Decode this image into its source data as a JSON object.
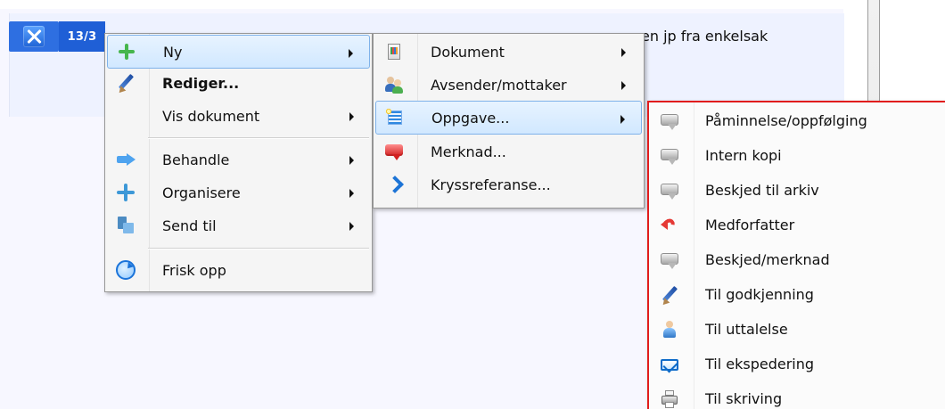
{
  "app": {
    "count_badge": "13/3",
    "background_text": "en jp fra enkelsak"
  },
  "menus": {
    "main": [
      {
        "label": "Ny",
        "icon": "plus-icon",
        "submenu": true,
        "highlight": true
      },
      {
        "label": "Rediger...",
        "icon": "pencil-icon",
        "submenu": false,
        "bold": true
      },
      {
        "label": "Vis dokument",
        "icon": "",
        "submenu": true
      },
      {
        "label": "Behandle",
        "icon": "forward-arrow-icon",
        "submenu": true
      },
      {
        "label": "Organisere",
        "icon": "move-icon",
        "submenu": true
      },
      {
        "label": "Send til",
        "icon": "send-icon",
        "submenu": true
      },
      {
        "label": "Frisk opp",
        "icon": "refresh-icon",
        "submenu": false
      }
    ],
    "ny": [
      {
        "label": "Dokument",
        "icon": "document-icon",
        "submenu": true
      },
      {
        "label": "Avsender/mottaker",
        "icon": "users-icon",
        "submenu": true
      },
      {
        "label": "Oppgave...",
        "icon": "task-icon",
        "submenu": true,
        "highlight": true
      },
      {
        "label": "Merknad...",
        "icon": "red-note-icon",
        "submenu": false
      },
      {
        "label": "Kryssreferanse...",
        "icon": "chevron-right-icon",
        "submenu": false
      }
    ],
    "oppgave": [
      {
        "label": "Påminnelse/oppfølging",
        "icon": "comment-icon"
      },
      {
        "label": "Intern kopi",
        "icon": "comment-icon"
      },
      {
        "label": "Beskjed til arkiv",
        "icon": "comment-icon"
      },
      {
        "label": "Medforfatter",
        "icon": "undo-icon"
      },
      {
        "label": "Beskjed/merknad",
        "icon": "comment-icon"
      },
      {
        "label": "Til godkjenning",
        "icon": "pencil-icon"
      },
      {
        "label": "Til uttalelse",
        "icon": "user-icon"
      },
      {
        "label": "Til ekspedering",
        "icon": "mail-icon"
      },
      {
        "label": "Til skriving",
        "icon": "printer-icon"
      }
    ]
  },
  "colors": {
    "highlight_border": "#7fb2ea",
    "highlight_fill": "#d1e8ff",
    "menu_border": "#979797",
    "accent_blue": "#1f5fd6",
    "callout_red": "#e11d1d"
  }
}
